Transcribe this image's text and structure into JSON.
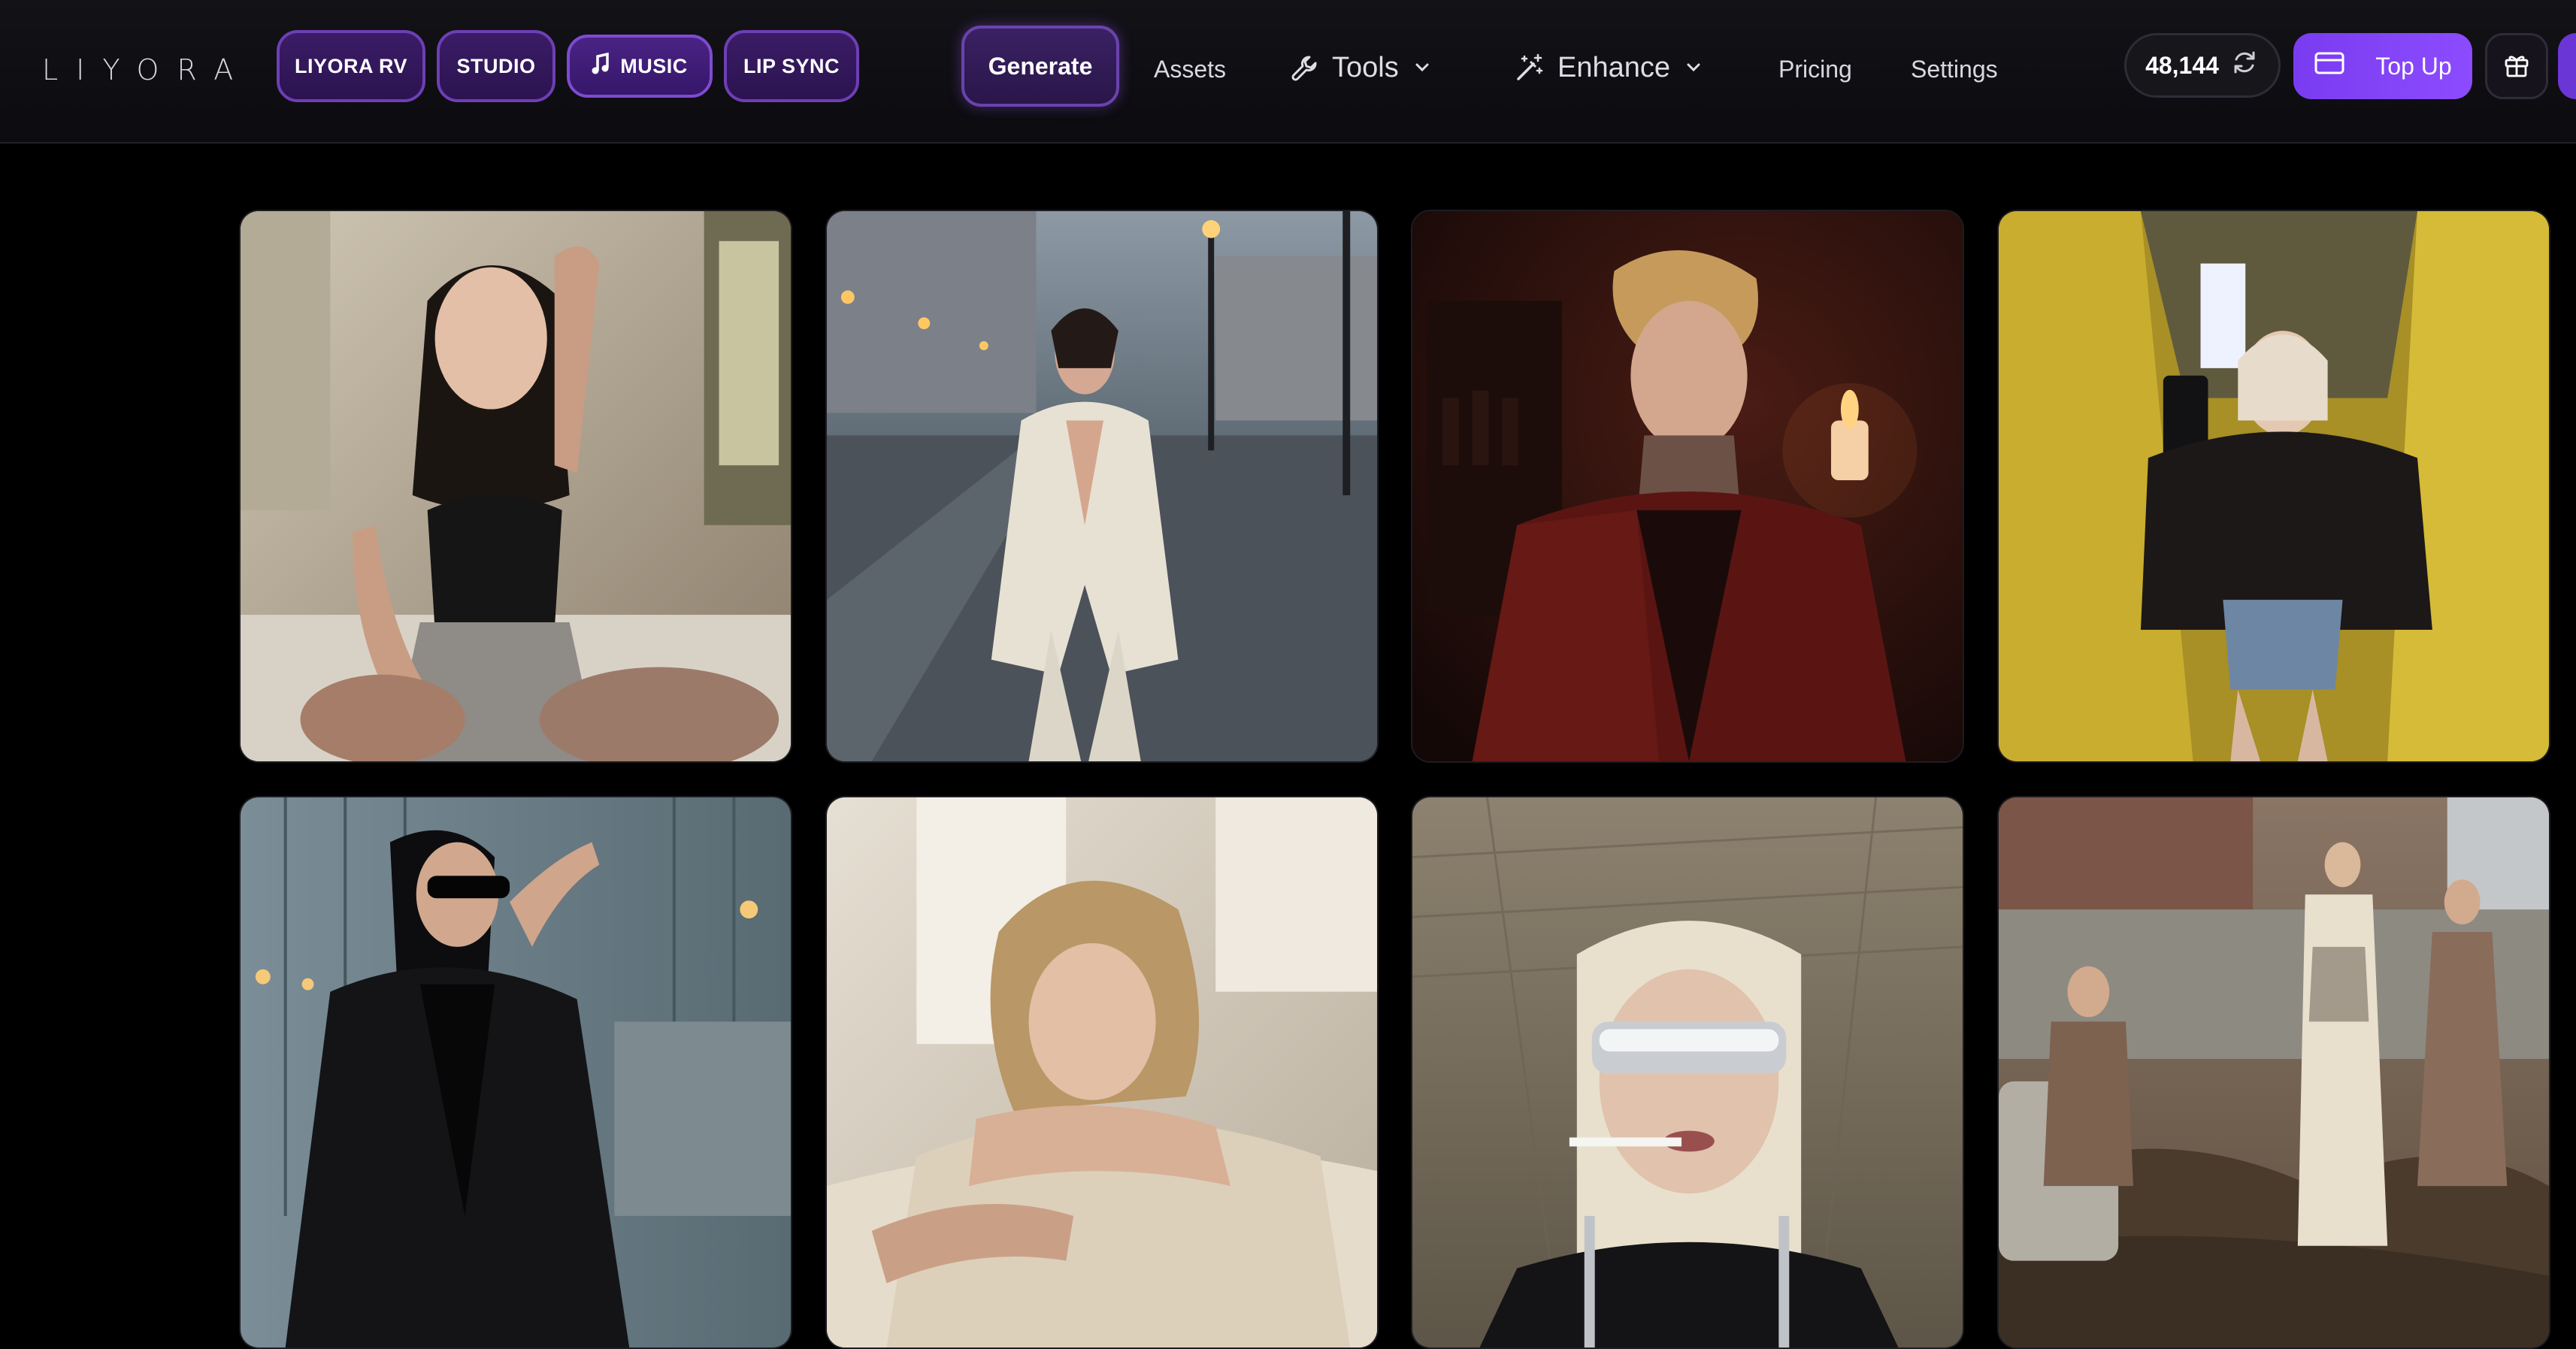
{
  "brand": {
    "logo_text": "LIYORA"
  },
  "header": {
    "mode_pills": [
      {
        "label": "LIYORA RV"
      },
      {
        "label": "STUDIO"
      },
      {
        "label": "MUSIC",
        "icon": "music-note-icon"
      },
      {
        "label": "LIP SYNC"
      }
    ],
    "nav": {
      "generate": "Generate",
      "assets": "Assets",
      "tools": "Tools",
      "enhance": "Enhance",
      "pricing": "Pricing",
      "settings": "Settings"
    },
    "credits": "48,144",
    "top_up": "Top Up"
  },
  "colors": {
    "accent": "#7a3cf0",
    "pill_border": "#6d3fb4",
    "background": "#000000"
  },
  "gallery": {
    "images": [
      {
        "name": "tattooed-woman-bedroom"
      },
      {
        "name": "woman-white-suit-rainy-street"
      },
      {
        "name": "blond-man-red-plaid-jacket"
      },
      {
        "name": "woman-leather-jacket-selfie-yellow-hallway"
      },
      {
        "name": "woman-sunglasses-black-coat"
      },
      {
        "name": "blonde-woman-lying-on-fur"
      },
      {
        "name": "woman-silver-visor-cigarette"
      },
      {
        "name": "three-women-construction-site"
      }
    ]
  }
}
